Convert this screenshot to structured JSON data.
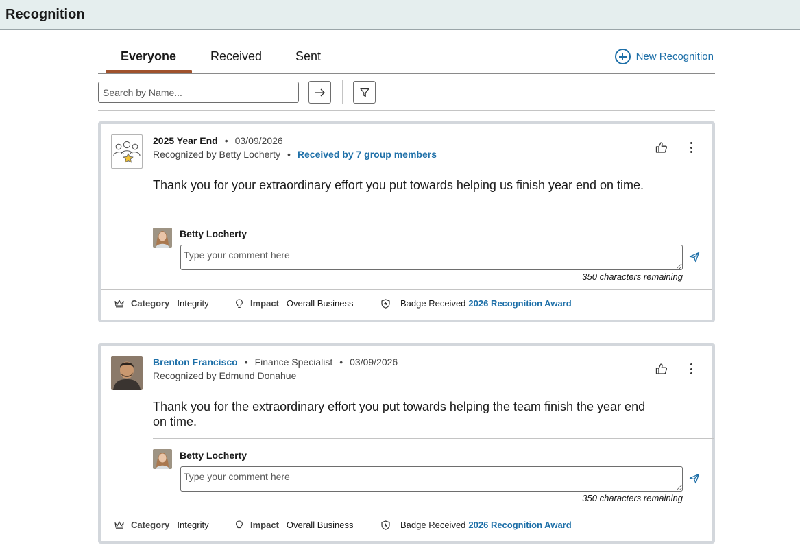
{
  "header": {
    "title": "Recognition"
  },
  "tabs": [
    {
      "label": "Everyone",
      "active": true
    },
    {
      "label": "Received",
      "active": false
    },
    {
      "label": "Sent",
      "active": false
    }
  ],
  "new_recognition_label": "New Recognition",
  "search": {
    "placeholder": "Search by Name...",
    "value": ""
  },
  "icons": {
    "go": "arrow-right-icon",
    "filter": "filter-icon",
    "like": "thumbs-up-icon",
    "more": "more-vertical-icon",
    "send": "send-icon",
    "category": "crown-icon",
    "impact": "lightbulb-icon",
    "badge": "shield-star-icon"
  },
  "colors": {
    "accent": "#1d6fa8",
    "tab_underline": "#a0522d",
    "topbar": "#e5eeee"
  },
  "cards": [
    {
      "title": "2025 Year End",
      "date": "03/09/2026",
      "recognized_by": "Recognized by Betty Locherty",
      "received_by": "Received by 7 group members",
      "message": "Thank you for your extraordinary effort you put towards helping us finish year end on time.",
      "comment": {
        "author": "Betty Locherty",
        "placeholder": "Type your comment here",
        "remaining": "350 characters remaining"
      },
      "footer": {
        "category_label": "Category",
        "category_value": "Integrity",
        "impact_label": "Impact",
        "impact_value": "Overall Business",
        "badge_label": "Badge Received",
        "badge_value": "2026 Recognition Award"
      }
    },
    {
      "name": "Brenton Francisco",
      "job_title": "Finance Specialist",
      "date": "03/09/2026",
      "recognized_by": "Recognized by Edmund Donahue",
      "message": "Thank you for the extraordinary effort you put towards helping the team finish the year end on time.",
      "comment": {
        "author": "Betty Locherty",
        "placeholder": "Type your comment here",
        "remaining": "350 characters remaining"
      },
      "footer": {
        "category_label": "Category",
        "category_value": "Integrity",
        "impact_label": "Impact",
        "impact_value": "Overall Business",
        "badge_label": "Badge Received",
        "badge_value": "2026 Recognition Award"
      }
    }
  ]
}
